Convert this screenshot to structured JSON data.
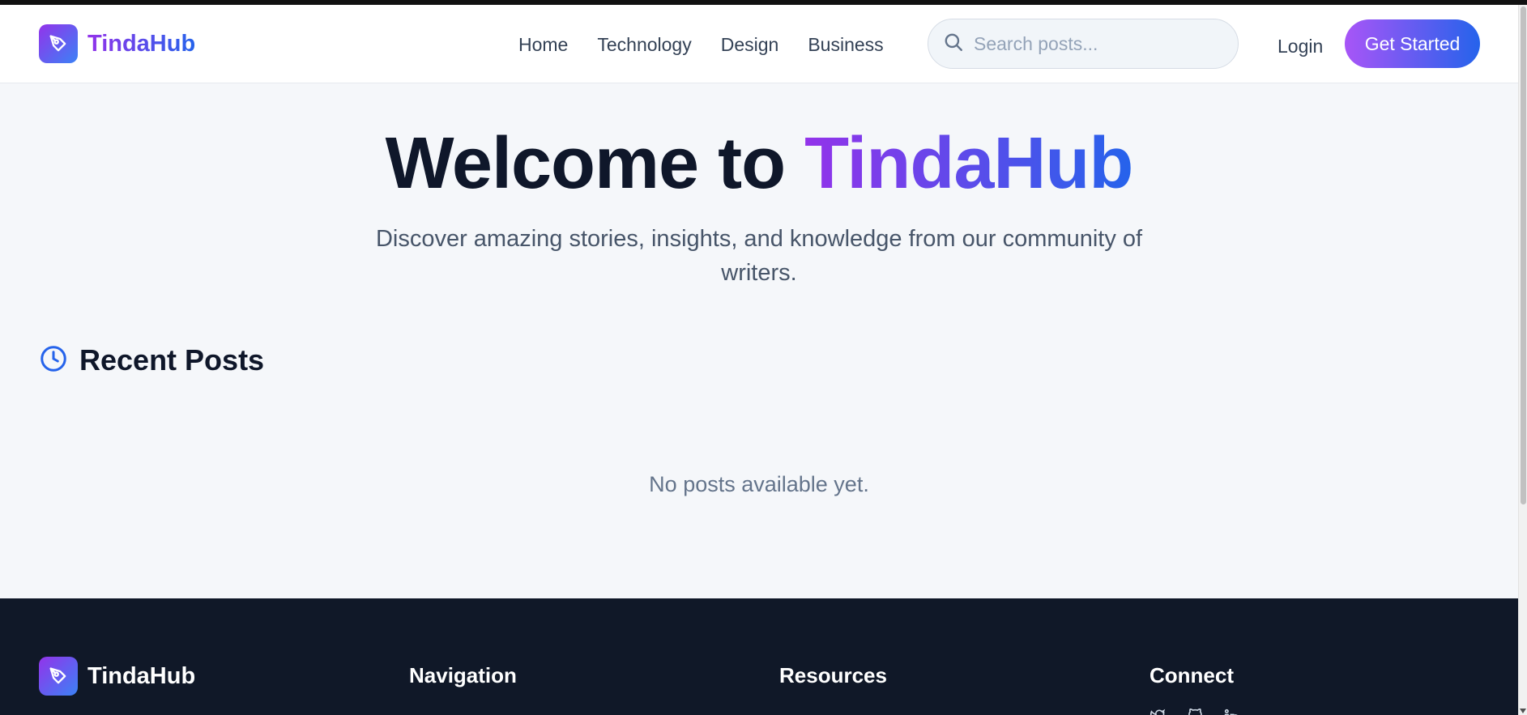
{
  "header": {
    "brand": "TindaHub",
    "nav": [
      "Home",
      "Technology",
      "Design",
      "Business"
    ],
    "search_placeholder": "Search posts...",
    "login": "Login",
    "cta": "Get Started"
  },
  "hero": {
    "title_prefix": "Welcome to",
    "title_highlight": "TindaHub",
    "subtitle": "Discover amazing stories, insights, and knowledge from our community of writers."
  },
  "recent": {
    "title": "Recent Posts",
    "empty_text": "No posts available yet."
  },
  "footer": {
    "brand": "TindaHub",
    "columns": [
      "Navigation",
      "Resources",
      "Connect"
    ],
    "social_icons": [
      "twitter-icon",
      "github-icon",
      "linkedin-icon"
    ]
  },
  "colors": {
    "gradient_start": "#9333ea",
    "gradient_end": "#2563eb",
    "footer_bg": "#101828",
    "heading": "#0f172a"
  }
}
